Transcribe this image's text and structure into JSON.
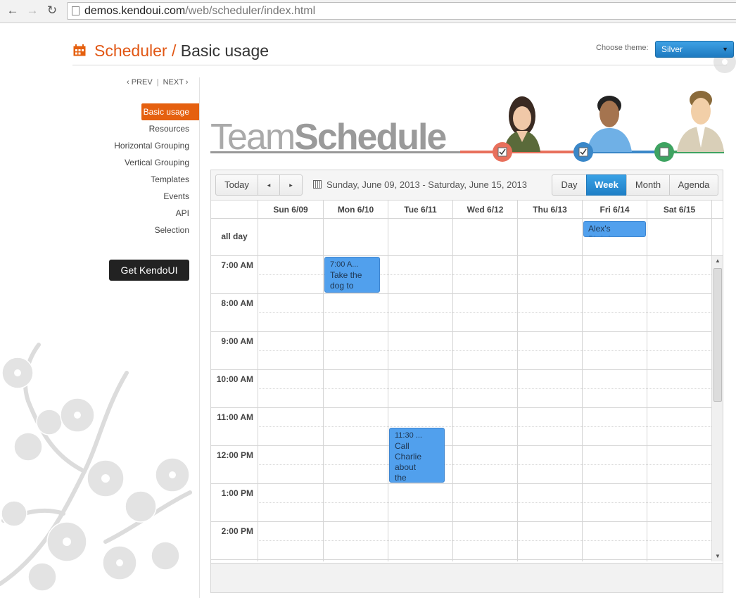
{
  "browser": {
    "url_domain": "demos.kendoui.com",
    "url_path": "/web/scheduler/index.html"
  },
  "header": {
    "section": "Scheduler /",
    "page": "Basic usage"
  },
  "theme": {
    "label": "Choose theme:",
    "value": "Silver"
  },
  "pager": {
    "prev": "PREV",
    "next": "NEXT"
  },
  "nav": {
    "items": [
      "Basic usage",
      "Resources",
      "Horizontal Grouping",
      "Vertical Grouping",
      "Templates",
      "Events",
      "API",
      "Selection"
    ],
    "active": "Basic usage"
  },
  "get_button": "Get KendoUI",
  "banner": {
    "logo_light": "Team",
    "logo_bold": "Schedule",
    "people": [
      {
        "color": "#e8705c",
        "checked": true
      },
      {
        "color": "#3a87c8",
        "checked": true
      },
      {
        "color": "#3ea361",
        "checked": false
      }
    ]
  },
  "toolbar": {
    "today": "Today",
    "prev_icon": "◂",
    "next_icon": "▸",
    "date_range": "Sunday, June 09, 2013 - Saturday, June 15, 2013",
    "views": [
      "Day",
      "Week",
      "Month",
      "Agenda"
    ],
    "active_view": "Week"
  },
  "days": [
    "Sun 6/09",
    "Mon 6/10",
    "Tue 6/11",
    "Wed 6/12",
    "Thu 6/13",
    "Fri 6/14",
    "Sat 6/15"
  ],
  "allday_label": "all day",
  "hours": [
    "7:00 AM",
    "8:00 AM",
    "9:00 AM",
    "10:00 AM",
    "11:00 AM",
    "12:00 PM",
    "1:00 PM",
    "2:00 PM"
  ],
  "events": {
    "allday": {
      "title": "Alex's Birthday"
    },
    "dog": {
      "time": "7:00 A...",
      "line1": "Take the",
      "line2": "dog to"
    },
    "charlie": {
      "time": "11:30 ...",
      "line1": "Call",
      "line2": "Charlie",
      "line3": "about",
      "line4": "the"
    }
  },
  "colors": {
    "accent": "#e5600f",
    "selected": "#2a8bd6",
    "event": "#51a0ed"
  }
}
